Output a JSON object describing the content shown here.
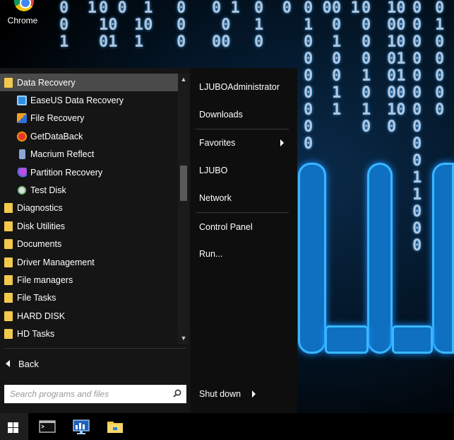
{
  "desktop": {
    "icons": [
      {
        "label": "Chrome",
        "icon": "chrome-icon"
      }
    ]
  },
  "start_menu": {
    "programs": [
      {
        "label": "Data Recovery",
        "type": "folder",
        "selected": true
      },
      {
        "label": "EaseUS Data Recovery",
        "type": "app",
        "icon": "easeus-icon"
      },
      {
        "label": "File Recovery",
        "type": "app",
        "icon": "file-recovery-icon"
      },
      {
        "label": "GetDataBack",
        "type": "app",
        "icon": "getdataback-icon"
      },
      {
        "label": "Macrium Reflect",
        "type": "app",
        "icon": "macrium-icon"
      },
      {
        "label": "Partition Recovery",
        "type": "app",
        "icon": "partition-recovery-icon"
      },
      {
        "label": "Test Disk",
        "type": "app",
        "icon": "testdisk-icon"
      },
      {
        "label": "Diagnostics",
        "type": "folder"
      },
      {
        "label": "Disk Utilities",
        "type": "folder"
      },
      {
        "label": "Documents",
        "type": "folder"
      },
      {
        "label": "Driver Management",
        "type": "folder"
      },
      {
        "label": "File managers",
        "type": "folder"
      },
      {
        "label": "File Tasks",
        "type": "folder"
      },
      {
        "label": "HARD DISK",
        "type": "folder"
      },
      {
        "label": "HD Tasks",
        "type": "folder"
      }
    ],
    "back_label": "Back",
    "search": {
      "placeholder": "Search programs and files"
    },
    "right_items": {
      "user": "LJUBOAdministrator",
      "downloads": "Downloads",
      "favorites": "Favorites",
      "ljubo": "LJUBO",
      "network": "Network",
      "control_panel": "Control Panel",
      "run": "Run...",
      "shutdown": "Shut down"
    }
  },
  "taskbar": {
    "items": [
      "start-button",
      "terminal-icon",
      "network-monitor-icon",
      "file-explorer-icon"
    ]
  },
  "colors": {
    "menu_bg": "#151515",
    "selected_bg": "#4a4a4a",
    "folder_icon": "#f3c94d",
    "wallpaper_accent": "#1a8cff"
  }
}
